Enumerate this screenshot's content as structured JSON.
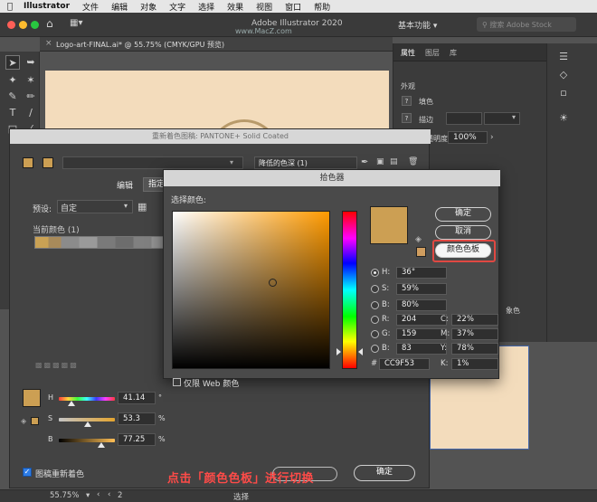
{
  "menubar": {
    "app": "Illustrator",
    "items": [
      "文件",
      "编辑",
      "对象",
      "文字",
      "选择",
      "效果",
      "视图",
      "窗口",
      "帮助"
    ]
  },
  "appbar": {
    "title": "Adobe Illustrator 2020",
    "workspace": "基本功能",
    "stock_placeholder": "搜索 Adobe Stock",
    "watermark": "www.MacZ.com"
  },
  "document": {
    "tab_label": "Logo-art-FINAL.ai* @ 55.75% (CMYK/GPU 预览)",
    "close_glyph": "×"
  },
  "properties_panel": {
    "tabs": [
      "属性",
      "图层",
      "库"
    ],
    "appearance_label": "外观",
    "fill_label": "填色",
    "stroke_label": "描边",
    "opacity_label": "不透明度",
    "opacity_value": "100%",
    "partial_label": "象色"
  },
  "recolor_dialog": {
    "title": "重新着色图稿: PANTONE+ Solid Coated",
    "reduce_depth": "降低的色深 (1)",
    "tabs": {
      "edit": "编辑",
      "assign": "指定"
    },
    "preset_label": "预设:",
    "preset_value": "自定",
    "current_colors_label": "当前颜色 (1)",
    "h_label": "H",
    "h_value": "41.14",
    "h_unit": "°",
    "s_label": "S",
    "s_value": "53.3",
    "s_unit": "%",
    "b_label": "B",
    "b_value": "77.25",
    "b_unit": "%",
    "recolor_art_label": "图稿重新着色",
    "ok_label": "确定",
    "swatch_color": "#cc9f53"
  },
  "color_picker": {
    "title": "拾色器",
    "select_color_label": "选择颜色:",
    "ok": "确定",
    "cancel": "取消",
    "swatches": "颜色色板",
    "current_color": "#cc9f53",
    "hsb": [
      {
        "label": "H:",
        "value": "36°",
        "checked": true
      },
      {
        "label": "S:",
        "value": "59%",
        "checked": false
      },
      {
        "label": "B:",
        "value": "80%",
        "checked": false
      }
    ],
    "rgb": [
      {
        "label": "R:",
        "value": "204"
      },
      {
        "label": "G:",
        "value": "159"
      },
      {
        "label": "B:",
        "value": "83"
      }
    ],
    "cmyk": [
      {
        "label": "C:",
        "value": "22%"
      },
      {
        "label": "M:",
        "value": "37%"
      },
      {
        "label": "Y:",
        "value": "78%"
      },
      {
        "label": "K:",
        "value": "1%"
      }
    ],
    "hex_label": "#",
    "hex_value": "CC9F53",
    "web_only_label": "仅限 Web 颜色"
  },
  "statusbar": {
    "zoom": "55.75%",
    "artboard": "2",
    "mode": "选择"
  },
  "annotation": {
    "caption": "点击「颜色色板」进行切换",
    "highlight_color": "#e04842"
  }
}
